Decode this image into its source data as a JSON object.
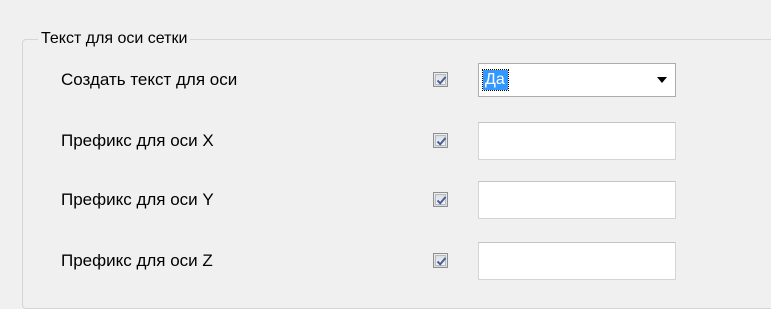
{
  "group": {
    "title": "Текст для оси сетки"
  },
  "rows": [
    {
      "label": "Создать текст для оси",
      "checked": true,
      "control": "combo",
      "value": "Да"
    },
    {
      "label": "Префикс для оси X",
      "checked": true,
      "control": "text",
      "value": ""
    },
    {
      "label": "Префикс для оси Y",
      "checked": true,
      "control": "text",
      "value": ""
    },
    {
      "label": "Префикс для оси Z",
      "checked": true,
      "control": "text",
      "value": ""
    }
  ],
  "icons": {
    "checkbox_mark": "checkmark-icon",
    "combo_arrow": "chevron-down-icon"
  },
  "colors": {
    "background": "#f0f0f0",
    "selection": "#3399ff",
    "checkmark": "#4a5f97"
  }
}
